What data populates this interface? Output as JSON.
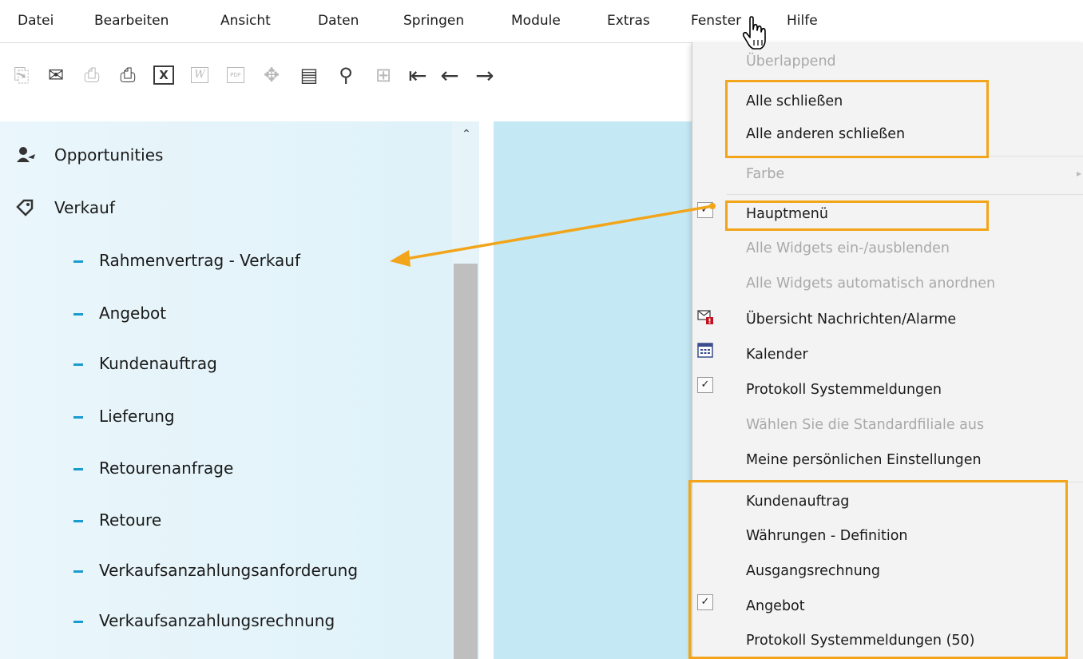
{
  "menubar": {
    "items": [
      "Datei",
      "Bearbeiten",
      "Ansicht",
      "Daten",
      "Springen",
      "Module",
      "Extras",
      "Fenster",
      "Hilfe"
    ]
  },
  "toolbar": {
    "icons": [
      {
        "name": "preview-icon",
        "glyph": "⎘",
        "state": "disabled"
      },
      {
        "name": "send-email-icon",
        "glyph": "✉",
        "state": "enabled"
      },
      {
        "name": "print-preview-icon",
        "glyph": "⎙",
        "state": "disabled"
      },
      {
        "name": "print-icon",
        "glyph": "⎙",
        "state": "enabled"
      },
      {
        "name": "excel-export-icon",
        "glyph": "X",
        "state": "enabled"
      },
      {
        "name": "word-export-icon",
        "glyph": "W",
        "state": "disabled"
      },
      {
        "name": "pdf-export-icon",
        "glyph": "PDF",
        "state": "disabled"
      },
      {
        "name": "move-icon",
        "glyph": "✥",
        "state": "disabled"
      },
      {
        "name": "lock-form-icon",
        "glyph": "▤",
        "state": "enabled"
      },
      {
        "name": "find-icon",
        "glyph": "⚲",
        "state": "enabled"
      },
      {
        "name": "add-record-icon",
        "glyph": "⊞",
        "state": "disabled"
      },
      {
        "name": "first-record-icon",
        "glyph": "⇤",
        "state": "enabled"
      },
      {
        "name": "previous-record-icon",
        "glyph": "←",
        "state": "enabled"
      },
      {
        "name": "next-record-icon",
        "glyph": "→",
        "state": "enabled"
      }
    ]
  },
  "sidebar": {
    "top_items": [
      {
        "label": "Opportunities",
        "icon": "opportunities-icon"
      },
      {
        "label": "Verkauf",
        "icon": "sales-icon"
      }
    ],
    "sub_items": [
      "Rahmenvertrag - Verkauf",
      "Angebot",
      "Kundenauftrag",
      "Lieferung",
      "Retourenanfrage",
      "Retoure",
      "Verkaufsanzahlungsanforderung",
      "Verkaufsanzahlungsrechnung"
    ]
  },
  "dropdown": {
    "items": [
      {
        "label": "Überlappend",
        "enabled": false
      },
      {
        "label": "Alle schließen",
        "enabled": true
      },
      {
        "label": "Alle anderen schließen",
        "enabled": true
      },
      {
        "label": "Farbe",
        "enabled": false,
        "submenu": true
      },
      {
        "label": "Hauptmenü",
        "enabled": true,
        "checked": true
      },
      {
        "label": "Alle Widgets ein-/ausblenden",
        "enabled": false
      },
      {
        "label": "Alle Widgets automatisch anordnen",
        "enabled": false
      },
      {
        "label": "Übersicht Nachrichten/Alarme",
        "enabled": true,
        "icon": "messages-alarm-icon"
      },
      {
        "label": "Kalender",
        "enabled": true,
        "icon": "calendar-icon"
      },
      {
        "label": "Protokoll Systemmeldungen",
        "enabled": true,
        "checked": true
      },
      {
        "label": "Wählen Sie die Standardfiliale aus",
        "enabled": false
      },
      {
        "label": "Meine persönlichen Einstellungen",
        "enabled": true
      },
      {
        "label": "Kundenauftrag",
        "enabled": true
      },
      {
        "label": "Währungen - Definition",
        "enabled": true
      },
      {
        "label": "Ausgangsrechnung",
        "enabled": true
      },
      {
        "label": "Angebot",
        "enabled": true,
        "checked": true
      },
      {
        "label": "Protokoll Systemmeldungen (50)",
        "enabled": true
      }
    ]
  },
  "colors": {
    "highlight": "#f2a51a",
    "sidebar_bg": "#e4f4fa",
    "content_bg": "#c4e9f5",
    "scroll_thumb": "#bfbfbf",
    "dash_accent": "#1a9bd0",
    "disabled_text": "#a9a9a9"
  }
}
